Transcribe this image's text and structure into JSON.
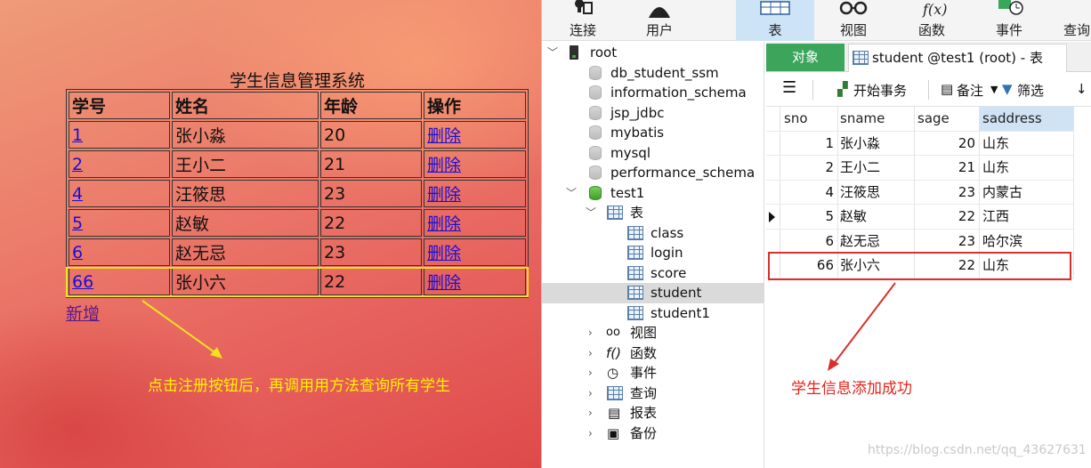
{
  "web": {
    "title": "学生信息管理系统",
    "columns": [
      "学号",
      "姓名",
      "年龄",
      "操作"
    ],
    "rows": [
      {
        "id": "1",
        "name": "张小淼",
        "age": "20",
        "action": "删除"
      },
      {
        "id": "2",
        "name": "王小二",
        "age": "21",
        "action": "删除"
      },
      {
        "id": "4",
        "name": "汪筱思",
        "age": "23",
        "action": "删除"
      },
      {
        "id": "5",
        "name": "赵敏",
        "age": "22",
        "action": "删除"
      },
      {
        "id": "6",
        "name": "赵无忌",
        "age": "23",
        "action": "删除"
      },
      {
        "id": "66",
        "name": "张小六",
        "age": "22",
        "action": "删除"
      }
    ],
    "add_link": "新增",
    "note": "点击注册按钮后，再调用用方法查询所有学生",
    "note_color": "#fff200"
  },
  "navicat": {
    "toolbar": [
      {
        "label": "连接",
        "icon": "connection-icon"
      },
      {
        "label": "用户",
        "icon": "user-icon"
      },
      {
        "label": "表",
        "icon": "table-icon",
        "active": true
      },
      {
        "label": "视图",
        "icon": "view-icon"
      },
      {
        "label": "函数",
        "icon": "function-icon"
      },
      {
        "label": "事件",
        "icon": "event-icon"
      },
      {
        "label": "查询",
        "icon": "query-icon"
      }
    ],
    "tree": {
      "root": "root",
      "databases": [
        "db_student_ssm",
        "information_schema",
        "jsp_jdbc",
        "mybatis",
        "mysql",
        "performance_schema"
      ],
      "open_db": "test1",
      "tables_folder": "表",
      "tables": [
        "class",
        "login",
        "score",
        "student",
        "student1"
      ],
      "selected_table": "student",
      "folders": [
        "视图",
        "函数",
        "事件",
        "查询",
        "报表",
        "备份"
      ]
    },
    "tabs": {
      "objects": "对象",
      "student": "student @test1 (root) - 表"
    },
    "subtoolbar": {
      "begin_transaction": "开始事务",
      "memo": "备注",
      "filter": "筛选"
    },
    "grid": {
      "columns": [
        "sno",
        "sname",
        "sage",
        "saddress"
      ],
      "rows": [
        {
          "sno": "1",
          "sname": "张小淼",
          "sage": "20",
          "saddress": "山东"
        },
        {
          "sno": "2",
          "sname": "王小二",
          "sage": "21",
          "saddress": "山东"
        },
        {
          "sno": "4",
          "sname": "汪筱思",
          "sage": "23",
          "saddress": "内蒙古"
        },
        {
          "sno": "5",
          "sname": "赵敏",
          "sage": "22",
          "saddress": "江西"
        },
        {
          "sno": "6",
          "sname": "赵无忌",
          "sage": "23",
          "saddress": "哈尔滨"
        },
        {
          "sno": "66",
          "sname": "张小六",
          "sage": "22",
          "saddress": "山东"
        }
      ],
      "current_row": 3
    },
    "note": "学生信息添加成功",
    "note_color": "#e4231d",
    "watermark": "https://blog.csdn.net/qq_43627631"
  },
  "colors": {
    "highlight_left": "#f3e01f",
    "highlight_right": "#d9302e",
    "objects_tab": "#3aa55b"
  }
}
